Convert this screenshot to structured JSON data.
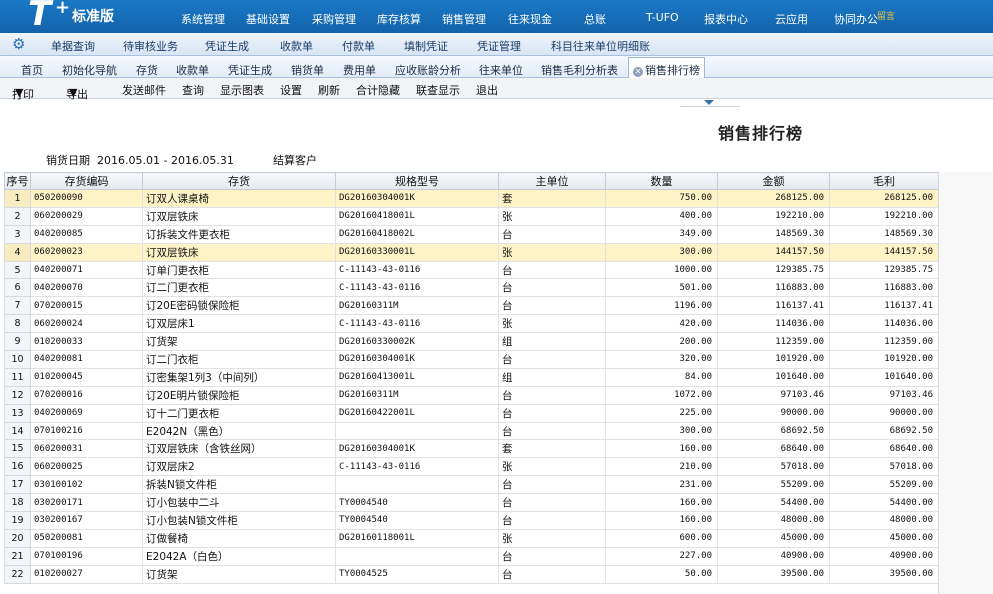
{
  "header": {
    "logo": "T+",
    "edition": "标准版",
    "menu": [
      "系统管理",
      "基础设置",
      "采购管理",
      "库存核算",
      "销售管理",
      "往来现金",
      "总账",
      "T-UFO",
      "报表中心",
      "云应用",
      "协同办公"
    ],
    "notify_badge": "留言"
  },
  "subnav": {
    "gear_icon": "gear-icon",
    "items": [
      "单据查询",
      "待审核业务",
      "凭证生成",
      "收款单",
      "付款单",
      "填制凭证",
      "凭证管理",
      "科目往来单位明细账"
    ]
  },
  "tabs": [
    "首页",
    "初始化导航",
    "存货",
    "收款单",
    "凭证生成",
    "销货单",
    "费用单",
    "应收账龄分析",
    "往来单位",
    "销售毛利分析表",
    "销售排行榜"
  ],
  "active_tab": "销售排行榜",
  "toolbar": {
    "print": "打印",
    "export": "导出",
    "send_mail": "发送邮件",
    "query": "查询",
    "show_chart": "显示图表",
    "settings": "设置",
    "refresh": "刷新",
    "subtotal_hide": "合计隐藏",
    "joint_show": "联查显示",
    "exit": "退出"
  },
  "report": {
    "title": "销售排行榜",
    "date_label": "销货日期",
    "date_range": "2016.05.01 - 2016.05.31",
    "customer_label": "结算客户"
  },
  "table": {
    "headers": [
      "序号",
      "存货编码",
      "存货",
      "规格型号",
      "主单位",
      "数量",
      "金额",
      "毛利"
    ],
    "rows": [
      {
        "seq": "1",
        "code": "050200090",
        "name": "订双人课桌椅",
        "spec": "DG20160304001K",
        "unit": "套",
        "qty": "750.00",
        "amount": "268125.00",
        "profit": "268125.00",
        "highlight": true
      },
      {
        "seq": "2",
        "code": "060200029",
        "name": "订双层铁床",
        "spec": "DG20160418001L",
        "unit": "张",
        "qty": "400.00",
        "amount": "192210.00",
        "profit": "192210.00",
        "highlight": false
      },
      {
        "seq": "3",
        "code": "040200085",
        "name": "订拆装文件更衣柜",
        "spec": "DG20160418002L",
        "unit": "台",
        "qty": "349.00",
        "amount": "148569.30",
        "profit": "148569.30",
        "highlight": false
      },
      {
        "seq": "4",
        "code": "060200023",
        "name": "订双层铁床",
        "spec": "DG20160330001L",
        "unit": "张",
        "qty": "300.00",
        "amount": "144157.50",
        "profit": "144157.50",
        "highlight": true
      },
      {
        "seq": "5",
        "code": "040200071",
        "name": "订单门更衣柜",
        "spec": "C-11143-43-0116",
        "unit": "台",
        "qty": "1000.00",
        "amount": "129385.75",
        "profit": "129385.75",
        "highlight": false
      },
      {
        "seq": "6",
        "code": "040200070",
        "name": "订二门更衣柜",
        "spec": "C-11143-43-0116",
        "unit": "台",
        "qty": "501.00",
        "amount": "116883.00",
        "profit": "116883.00",
        "highlight": false
      },
      {
        "seq": "7",
        "code": "070200015",
        "name": "订20E密码锁保险柜",
        "spec": "DG20160311M",
        "unit": "台",
        "qty": "1196.00",
        "amount": "116137.41",
        "profit": "116137.41",
        "highlight": false
      },
      {
        "seq": "8",
        "code": "060200024",
        "name": "订双层床1",
        "spec": "C-11143-43-0116",
        "unit": "张",
        "qty": "420.00",
        "amount": "114036.00",
        "profit": "114036.00",
        "highlight": false
      },
      {
        "seq": "9",
        "code": "010200033",
        "name": "订货架",
        "spec": "DG20160330002K",
        "unit": "组",
        "qty": "200.00",
        "amount": "112359.00",
        "profit": "112359.00",
        "highlight": false
      },
      {
        "seq": "10",
        "code": "040200081",
        "name": "订二门衣柜",
        "spec": "DG20160304001K",
        "unit": "台",
        "qty": "320.00",
        "amount": "101920.00",
        "profit": "101920.00",
        "highlight": false
      },
      {
        "seq": "11",
        "code": "010200045",
        "name": "订密集架1列3（中间列）",
        "spec": "DG20160413001L",
        "unit": "组",
        "qty": "84.00",
        "amount": "101640.00",
        "profit": "101640.00",
        "highlight": false
      },
      {
        "seq": "12",
        "code": "070200016",
        "name": "订20E明片锁保险柜",
        "spec": "DG20160311M",
        "unit": "台",
        "qty": "1072.00",
        "amount": "97103.46",
        "profit": "97103.46",
        "highlight": false
      },
      {
        "seq": "13",
        "code": "040200069",
        "name": "订十二门更衣柜",
        "spec": "DG20160422001L",
        "unit": "台",
        "qty": "225.00",
        "amount": "90000.00",
        "profit": "90000.00",
        "highlight": false
      },
      {
        "seq": "14",
        "code": "070100216",
        "name": "E2042N（黑色）",
        "spec": "",
        "unit": "台",
        "qty": "300.00",
        "amount": "68692.50",
        "profit": "68692.50",
        "highlight": false
      },
      {
        "seq": "15",
        "code": "060200031",
        "name": "订双层铁床（含铁丝网）",
        "spec": "DG20160304001K",
        "unit": "套",
        "qty": "160.00",
        "amount": "68640.00",
        "profit": "68640.00",
        "highlight": false
      },
      {
        "seq": "16",
        "code": "060200025",
        "name": "订双层床2",
        "spec": "C-11143-43-0116",
        "unit": "张",
        "qty": "210.00",
        "amount": "57018.00",
        "profit": "57018.00",
        "highlight": false
      },
      {
        "seq": "17",
        "code": "030100102",
        "name": "拆装N锁文件柜",
        "spec": "",
        "unit": "台",
        "qty": "231.00",
        "amount": "55209.00",
        "profit": "55209.00",
        "highlight": false
      },
      {
        "seq": "18",
        "code": "030200171",
        "name": "订小包装中二斗",
        "spec": "TY0004540",
        "unit": "台",
        "qty": "160.00",
        "amount": "54400.00",
        "profit": "54400.00",
        "highlight": false
      },
      {
        "seq": "19",
        "code": "030200167",
        "name": "订小包装N锁文件柜",
        "spec": "TY0004540",
        "unit": "台",
        "qty": "160.00",
        "amount": "48000.00",
        "profit": "48000.00",
        "highlight": false
      },
      {
        "seq": "20",
        "code": "050200081",
        "name": "订做餐椅",
        "spec": "DG20160118001L",
        "unit": "张",
        "qty": "600.00",
        "amount": "45000.00",
        "profit": "45000.00",
        "highlight": false
      },
      {
        "seq": "21",
        "code": "070100196",
        "name": "E2042A（白色）",
        "spec": "",
        "unit": "台",
        "qty": "227.00",
        "amount": "40900.00",
        "profit": "40900.00",
        "highlight": false
      },
      {
        "seq": "22",
        "code": "010200027",
        "name": "订货架",
        "spec": "TY0004525",
        "unit": "台",
        "qty": "50.00",
        "amount": "39500.00",
        "profit": "39500.00",
        "highlight": false
      }
    ]
  },
  "colors": {
    "header_blue": "#1a78c6",
    "highlight_row": "#fdf3c6"
  }
}
